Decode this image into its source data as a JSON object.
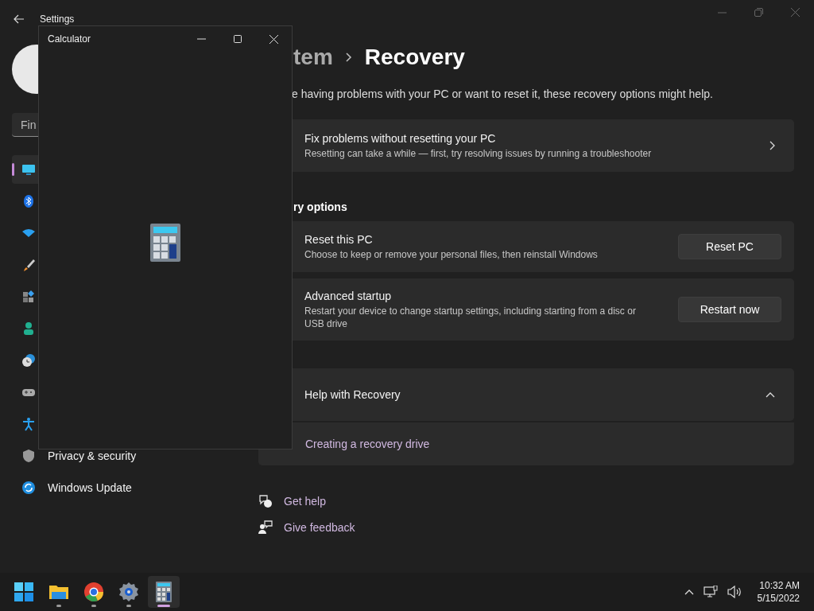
{
  "window": {
    "title": "Settings"
  },
  "calculator_window": {
    "title": "Calculator"
  },
  "sidebar": {
    "search": {
      "placeholder": "Fin"
    },
    "items": [
      {
        "selected": true
      },
      {
        "selected": false
      },
      {
        "selected": false
      },
      {
        "selected": false
      },
      {
        "selected": false
      },
      {
        "selected": false
      },
      {
        "selected": false
      },
      {
        "selected": false
      },
      {
        "selected": false
      },
      {
        "label": "Privacy & security",
        "selected": false
      },
      {
        "label": "Windows Update",
        "selected": false
      }
    ]
  },
  "breadcrumb": {
    "parent": "tem",
    "current": "Recovery"
  },
  "description": "e having problems with your PC or want to reset it, these recovery options might help.",
  "fix_card": {
    "title": "Fix problems without resetting your PC",
    "description": "Resetting can take a while — first, try resolving issues by running a troubleshooter"
  },
  "section_title": "ry options",
  "options": [
    {
      "title": "Reset this PC",
      "description": "Choose to keep or remove your personal files, then reinstall Windows",
      "button": "Reset PC"
    },
    {
      "title": "Advanced startup",
      "description": "Restart your device to change startup settings, including starting from a disc or USB drive",
      "button": "Restart now"
    }
  ],
  "help": {
    "title": "Help with Recovery",
    "expanded": true,
    "links": [
      "Creating a recovery drive"
    ]
  },
  "footer_links": [
    "Get help",
    "Give feedback"
  ],
  "taskbar": {
    "apps": [
      {
        "selected": false
      },
      {
        "selected": false
      },
      {
        "selected": false
      },
      {
        "selected": true
      }
    ],
    "time": "10:32 AM",
    "date": "5/15/2022"
  }
}
